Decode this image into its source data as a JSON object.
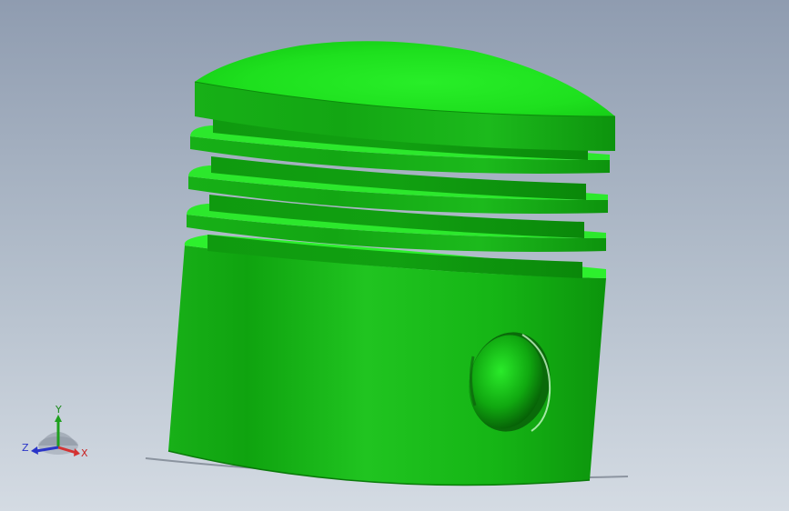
{
  "triad": {
    "x_label": "X",
    "y_label": "Y",
    "z_label": "Z"
  },
  "colors": {
    "background_top": "#8f9cb0",
    "background_bottom": "#d4dbe3",
    "part_green": "#16c216",
    "part_green_light": "#2ee62e",
    "part_green_dark": "#0a8a0a",
    "axis_x": "#d43232",
    "axis_y": "#1ea01e",
    "axis_z": "#2a35c8"
  }
}
